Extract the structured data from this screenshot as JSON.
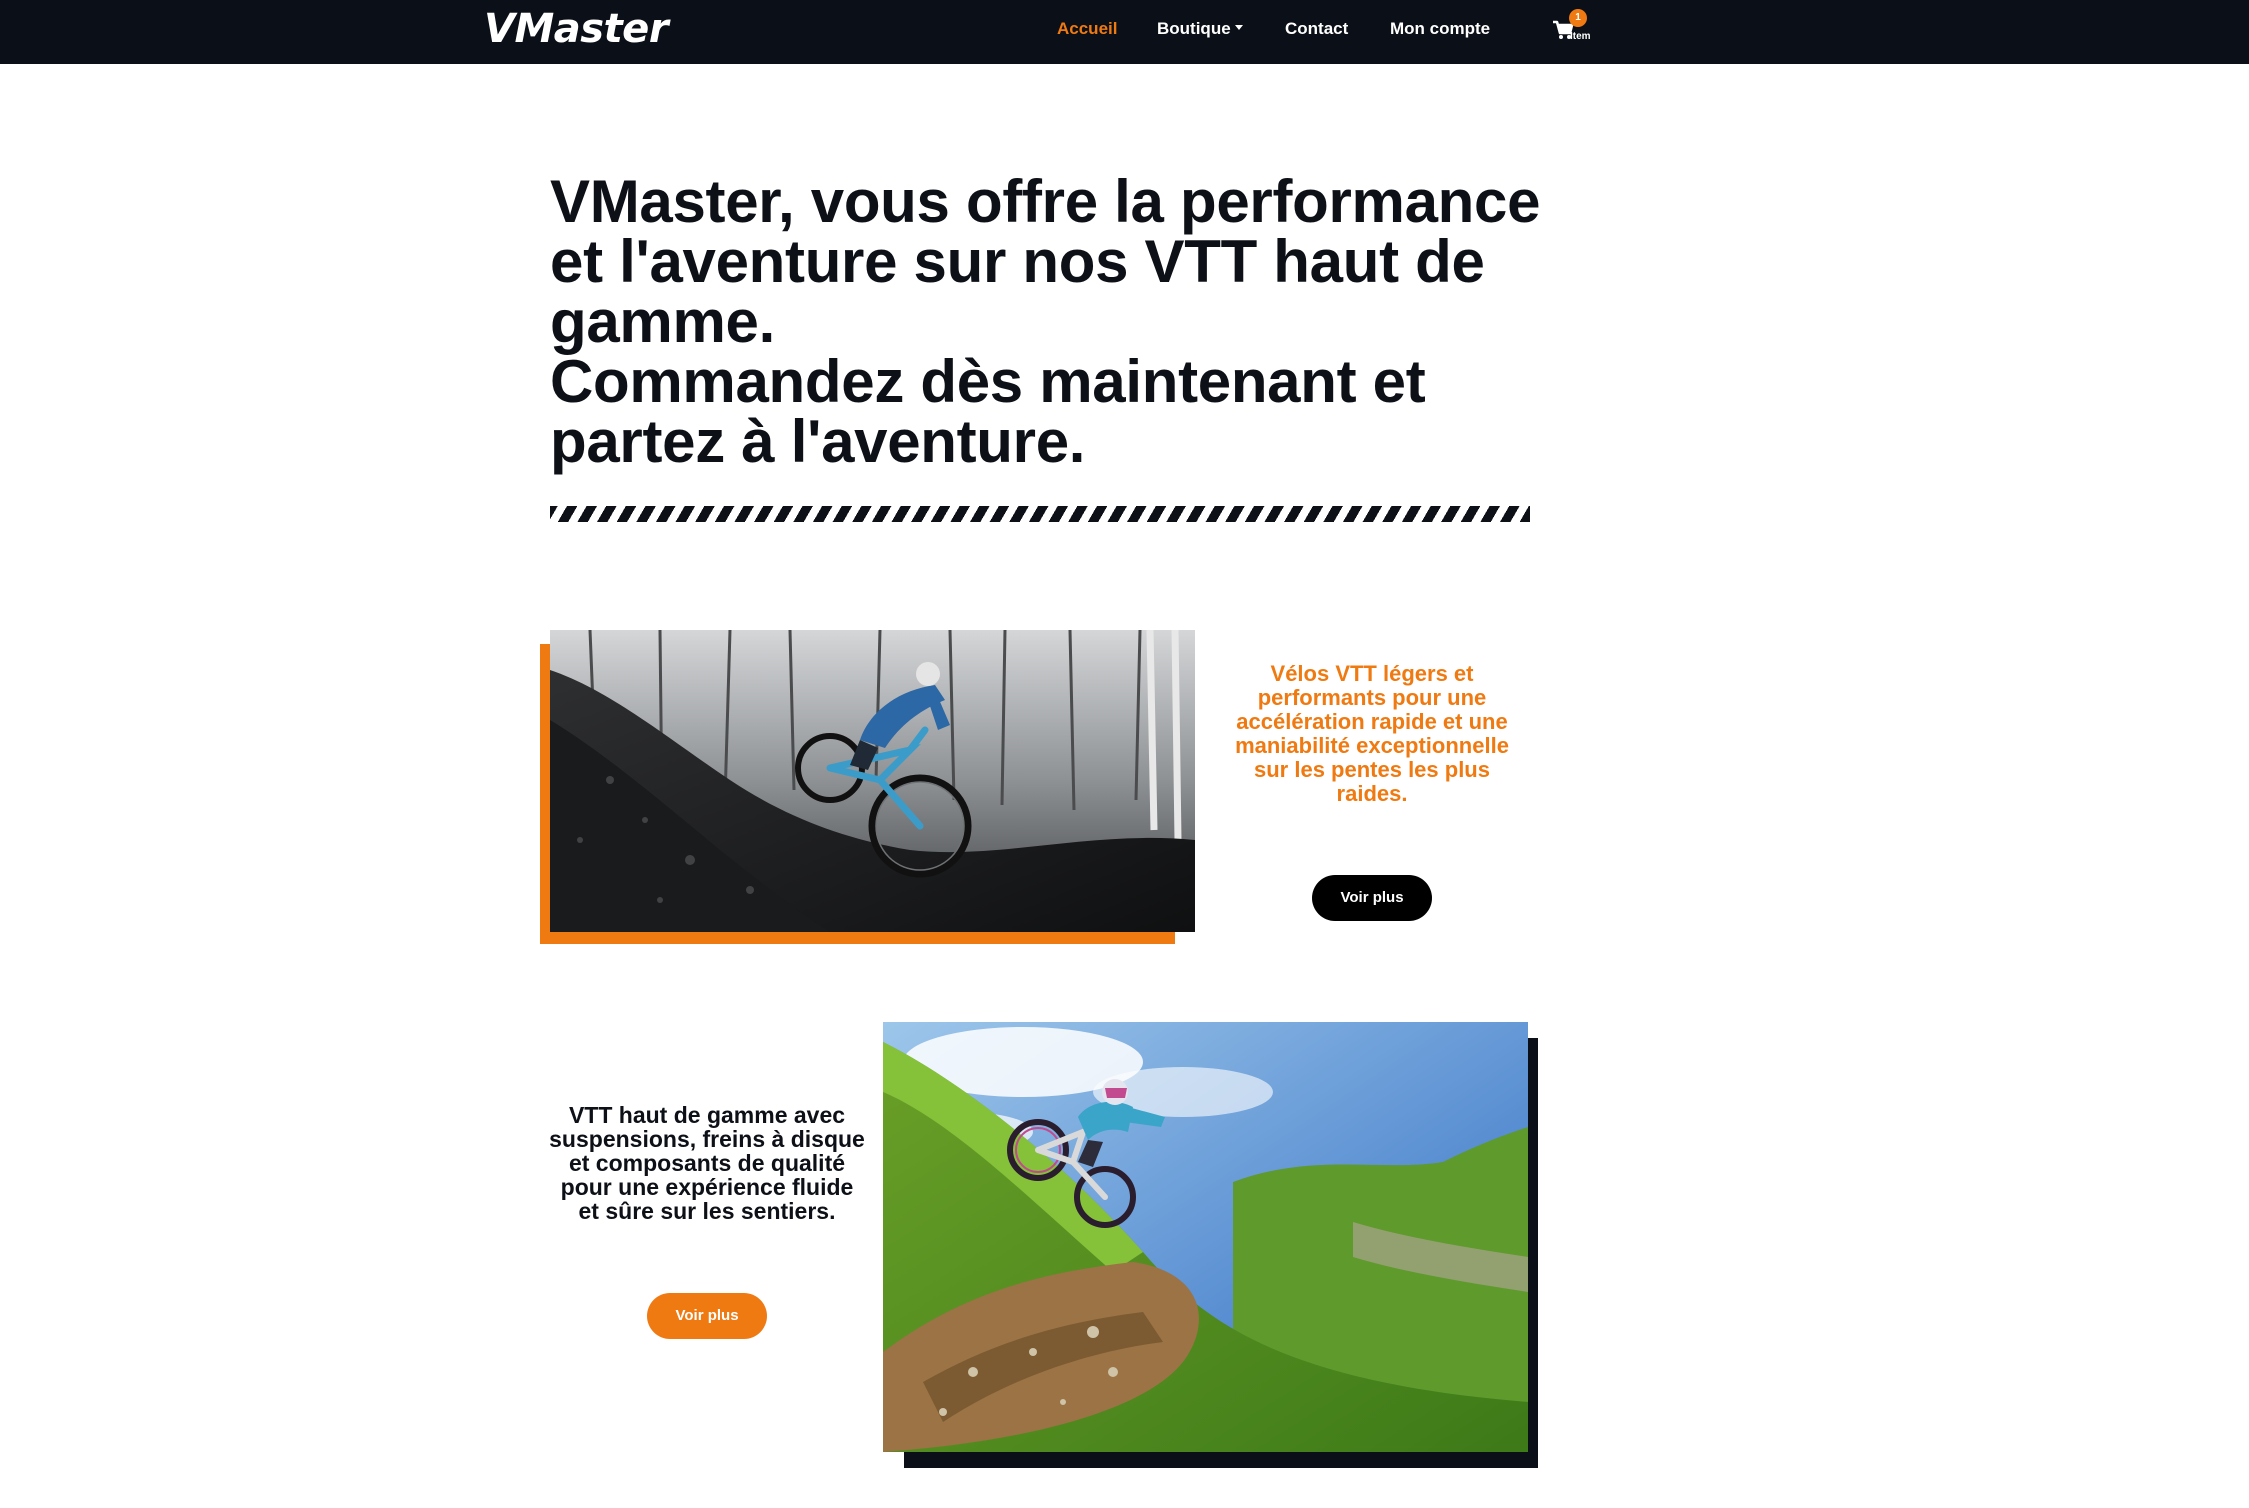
{
  "navbar": {
    "brand": "VMaster",
    "links": {
      "home": "Accueil",
      "shop": "Boutique",
      "contact": "Contact",
      "account": "Mon compte"
    },
    "cart": {
      "count": "1",
      "label": "Item",
      "icon": "cart-icon"
    },
    "active_color": "#f07a12"
  },
  "hero": {
    "title_line1": "VMaster, vous offre la performance",
    "title_line2": "et l'aventure sur nos VTT haut de",
    "title_line3": "gamme.",
    "title_line4": "Commandez dès maintenant et",
    "title_line5": "partez à l'aventure."
  },
  "features": [
    {
      "text": "Vélos VTT légers et performants pour une accélération rapide et une maniabilité exceptionnelle sur les pentes les plus raides.",
      "button": "Voir plus"
    },
    {
      "text": "VTT haut de gamme avec suspensions, freins à disque et composants de qualité pour une expérience fluide et sûre sur les sentiers.",
      "button": "Voir plus"
    }
  ],
  "colors": {
    "accent": "#f07a12",
    "dark": "#0b0f17",
    "text": "#0d1117"
  }
}
